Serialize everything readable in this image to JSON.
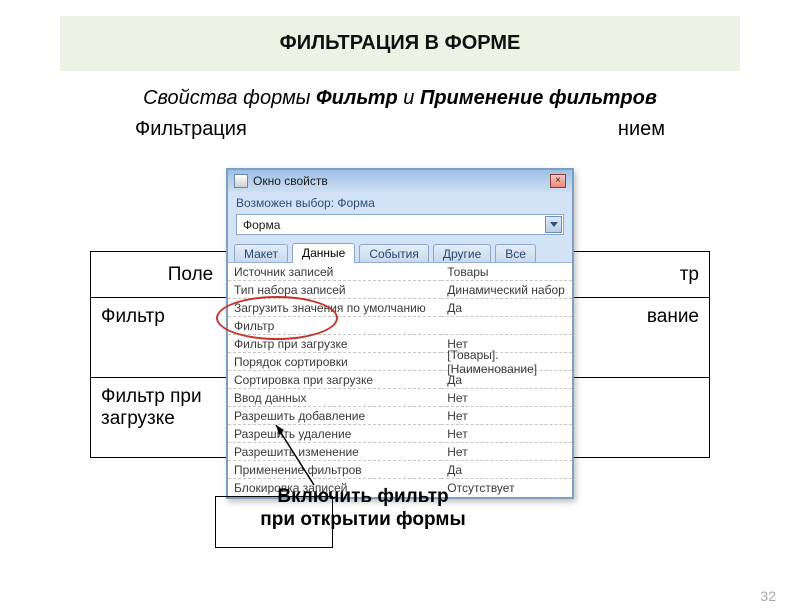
{
  "slide": {
    "title": "ФИЛЬТРАЦИЯ В ФОРМЕ",
    "subtitle_pre": "Свойства формы ",
    "subtitle_b1": "Фильтр",
    "subtitle_mid": " и ",
    "subtitle_b2": "Применение фильтров",
    "line2_pre": "Фильтрация",
    "line2_post": "нием",
    "bg_table": {
      "h1": "Поле",
      "h2": "тр",
      "r1c1": "Фильтр",
      "r1c2": "вание",
      "r2c1": "Фильтр при загрузке",
      "r2c2": ""
    },
    "callout": "Включить фильтр при открытии формы",
    "page": "32"
  },
  "win": {
    "title": "Окно свойств",
    "hint": "Возможен выбор: Форма",
    "combo_value": "Форма",
    "close": "×",
    "tabs": [
      "Макет",
      "Данные",
      "События",
      "Другие",
      "Все"
    ],
    "active_tab": 1,
    "rows": [
      {
        "k": "Источник записей",
        "v": "Товары"
      },
      {
        "k": "Тип набора записей",
        "v": "Динамический набор"
      },
      {
        "k": "Загрузить значения по умолчанию",
        "v": "Да"
      },
      {
        "k": "Фильтр",
        "v": ""
      },
      {
        "k": "Фильтр при загрузке",
        "v": "Нет"
      },
      {
        "k": "Порядок сортировки",
        "v": "[Товары].[Наименование]"
      },
      {
        "k": "Сортировка при загрузке",
        "v": "Да"
      },
      {
        "k": "Ввод данных",
        "v": "Нет"
      },
      {
        "k": "Разрешить добавление",
        "v": "Нет"
      },
      {
        "k": "Разрешить удаление",
        "v": "Нет"
      },
      {
        "k": "Разрешить изменение",
        "v": "Нет"
      },
      {
        "k": "Применение фильтров",
        "v": "Да"
      },
      {
        "k": "Блокировка записей",
        "v": "Отсутствует"
      }
    ]
  }
}
